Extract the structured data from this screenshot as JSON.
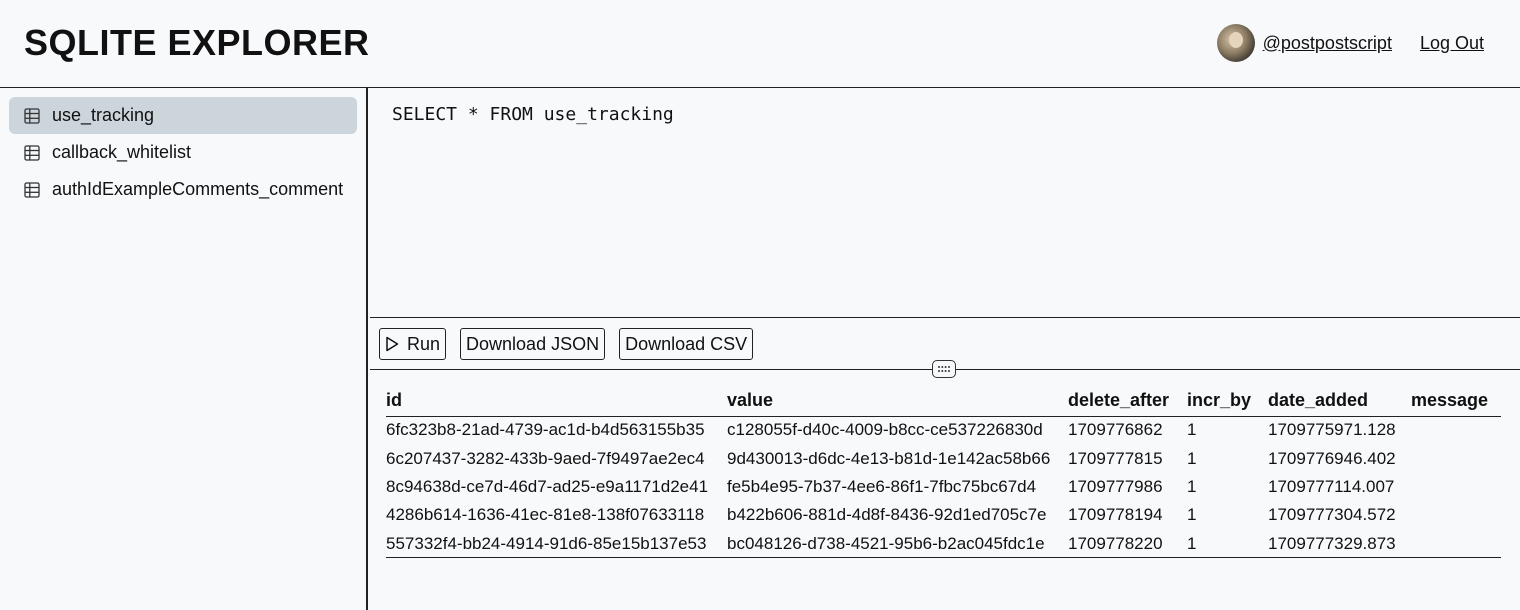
{
  "header": {
    "title": "SQLITE EXPLORER",
    "username": "@postpostscript",
    "logout_label": "Log Out"
  },
  "sidebar": {
    "tables": [
      {
        "label": "use_tracking",
        "active": true
      },
      {
        "label": "callback_whitelist",
        "active": false
      },
      {
        "label": "authIdExampleComments_comment",
        "active": false
      }
    ]
  },
  "editor": {
    "query": "SELECT * FROM use_tracking"
  },
  "toolbar": {
    "run_label": "Run",
    "download_json_label": "Download JSON",
    "download_csv_label": "Download CSV"
  },
  "results": {
    "columns": [
      "id",
      "value",
      "delete_after",
      "incr_by",
      "date_added",
      "message"
    ],
    "rows": [
      [
        "6fc323b8-21ad-4739-ac1d-b4d563155b35",
        "c128055f-d40c-4009-b8cc-ce537226830d",
        "1709776862",
        "1",
        "1709775971.128",
        ""
      ],
      [
        "6c207437-3282-433b-9aed-7f9497ae2ec4",
        "9d430013-d6dc-4e13-b81d-1e142ac58b66",
        "1709777815",
        "1",
        "1709776946.402",
        ""
      ],
      [
        "8c94638d-ce7d-46d7-ad25-e9a1171d2e41",
        "fe5b4e95-7b37-4ee6-86f1-7fbc75bc67d4",
        "1709777986",
        "1",
        "1709777114.007",
        ""
      ],
      [
        "4286b614-1636-41ec-81e8-138f07633118",
        "b422b606-881d-4d8f-8436-92d1ed705c7e",
        "1709778194",
        "1",
        "1709777304.572",
        ""
      ],
      [
        "557332f4-bb24-4914-91d6-85e15b137e53",
        "bc048126-d738-4521-95b6-b2ac045fdc1e",
        "1709778220",
        "1",
        "1709777329.873",
        ""
      ]
    ]
  },
  "icons": {
    "table": "table-icon",
    "run": "play-icon",
    "resize": "drag-handle-icon",
    "avatar": "avatar"
  }
}
